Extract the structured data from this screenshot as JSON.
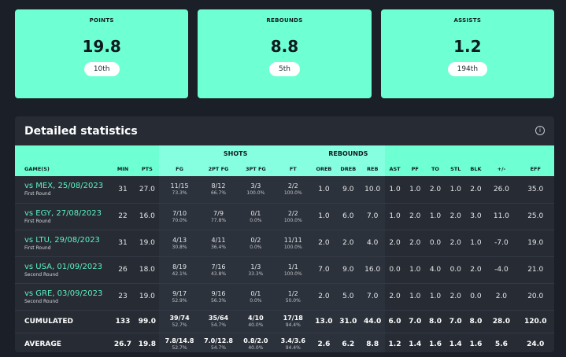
{
  "cards": [
    {
      "label": "POINTS",
      "value": "19.8",
      "rank": "10th"
    },
    {
      "label": "REBOUNDS",
      "value": "8.8",
      "rank": "5th"
    },
    {
      "label": "ASSISTS",
      "value": "1.2",
      "rank": "194th"
    }
  ],
  "panel": {
    "title": "Detailed statistics",
    "info_icon": "info-icon"
  },
  "groups": {
    "shots": "SHOTS",
    "rebounds": "REBOUNDS"
  },
  "headers": [
    "GAME(S)",
    "MIN",
    "PTS",
    "FG",
    "2PT FG",
    "3PT FG",
    "FT",
    "OREB",
    "DREB",
    "REB",
    "AST",
    "PF",
    "TO",
    "STL",
    "BLK",
    "+/-",
    "EFF"
  ],
  "games": [
    {
      "opp": "vs MEX, 25/08/2023",
      "round": "First Round",
      "min": "31",
      "pts": "27.0",
      "fg": "11/15",
      "fg_pct": "73.3%",
      "fg2": "8/12",
      "fg2_pct": "66.7%",
      "fg3": "3/3",
      "fg3_pct": "100.0%",
      "ft": "2/2",
      "ft_pct": "100.0%",
      "oreb": "1.0",
      "dreb": "9.0",
      "reb": "10.0",
      "ast": "1.0",
      "pf": "1.0",
      "to": "2.0",
      "stl": "1.0",
      "blk": "2.0",
      "pm": "26.0",
      "eff": "35.0"
    },
    {
      "opp": "vs EGY, 27/08/2023",
      "round": "First Round",
      "min": "22",
      "pts": "16.0",
      "fg": "7/10",
      "fg_pct": "70.0%",
      "fg2": "7/9",
      "fg2_pct": "77.8%",
      "fg3": "0/1",
      "fg3_pct": "0.0%",
      "ft": "2/2",
      "ft_pct": "100.0%",
      "oreb": "1.0",
      "dreb": "6.0",
      "reb": "7.0",
      "ast": "1.0",
      "pf": "2.0",
      "to": "1.0",
      "stl": "2.0",
      "blk": "3.0",
      "pm": "11.0",
      "eff": "25.0"
    },
    {
      "opp": "vs LTU, 29/08/2023",
      "round": "First Round",
      "min": "31",
      "pts": "19.0",
      "fg": "4/13",
      "fg_pct": "30.8%",
      "fg2": "4/11",
      "fg2_pct": "36.4%",
      "fg3": "0/2",
      "fg3_pct": "0.0%",
      "ft": "11/11",
      "ft_pct": "100.0%",
      "oreb": "2.0",
      "dreb": "2.0",
      "reb": "4.0",
      "ast": "2.0",
      "pf": "2.0",
      "to": "0.0",
      "stl": "2.0",
      "blk": "1.0",
      "pm": "-7.0",
      "eff": "19.0"
    },
    {
      "opp": "vs USA, 01/09/2023",
      "round": "Second Round",
      "min": "26",
      "pts": "18.0",
      "fg": "8/19",
      "fg_pct": "42.1%",
      "fg2": "7/16",
      "fg2_pct": "43.8%",
      "fg3": "1/3",
      "fg3_pct": "33.3%",
      "ft": "1/1",
      "ft_pct": "100.0%",
      "oreb": "7.0",
      "dreb": "9.0",
      "reb": "16.0",
      "ast": "0.0",
      "pf": "1.0",
      "to": "4.0",
      "stl": "0.0",
      "blk": "2.0",
      "pm": "-4.0",
      "eff": "21.0"
    },
    {
      "opp": "vs GRE, 03/09/2023",
      "round": "Second Round",
      "min": "23",
      "pts": "19.0",
      "fg": "9/17",
      "fg_pct": "52.9%",
      "fg2": "9/16",
      "fg2_pct": "56.3%",
      "fg3": "0/1",
      "fg3_pct": "0.0%",
      "ft": "1/2",
      "ft_pct": "50.0%",
      "oreb": "2.0",
      "dreb": "5.0",
      "reb": "7.0",
      "ast": "2.0",
      "pf": "1.0",
      "to": "1.0",
      "stl": "2.0",
      "blk": "0.0",
      "pm": "2.0",
      "eff": "20.0"
    }
  ],
  "totals": [
    {
      "label": "CUMULATED",
      "min": "133",
      "pts": "99.0",
      "fg": "39/74",
      "fg_pct": "52.7%",
      "fg2": "35/64",
      "fg2_pct": "54.7%",
      "fg3": "4/10",
      "fg3_pct": "40.0%",
      "ft": "17/18",
      "ft_pct": "94.4%",
      "oreb": "13.0",
      "dreb": "31.0",
      "reb": "44.0",
      "ast": "6.0",
      "pf": "7.0",
      "to": "8.0",
      "stl": "7.0",
      "blk": "8.0",
      "pm": "28.0",
      "eff": "120.0"
    },
    {
      "label": "AVERAGE",
      "min": "26.7",
      "pts": "19.8",
      "fg": "7.8/14.8",
      "fg_pct": "52.7%",
      "fg2": "7.0/12.8",
      "fg2_pct": "54.7%",
      "fg3": "0.8/2.0",
      "fg3_pct": "40.0%",
      "ft": "3.4/3.6",
      "ft_pct": "94.4%",
      "oreb": "2.6",
      "dreb": "6.2",
      "reb": "8.8",
      "ast": "1.2",
      "pf": "1.4",
      "to": "1.6",
      "stl": "1.4",
      "blk": "1.6",
      "pm": "5.6",
      "eff": "24.0"
    }
  ],
  "colors": {
    "accent": "#6effd2",
    "background": "#1b1f27",
    "panel": "#262b34",
    "link": "#5ef2c2"
  }
}
